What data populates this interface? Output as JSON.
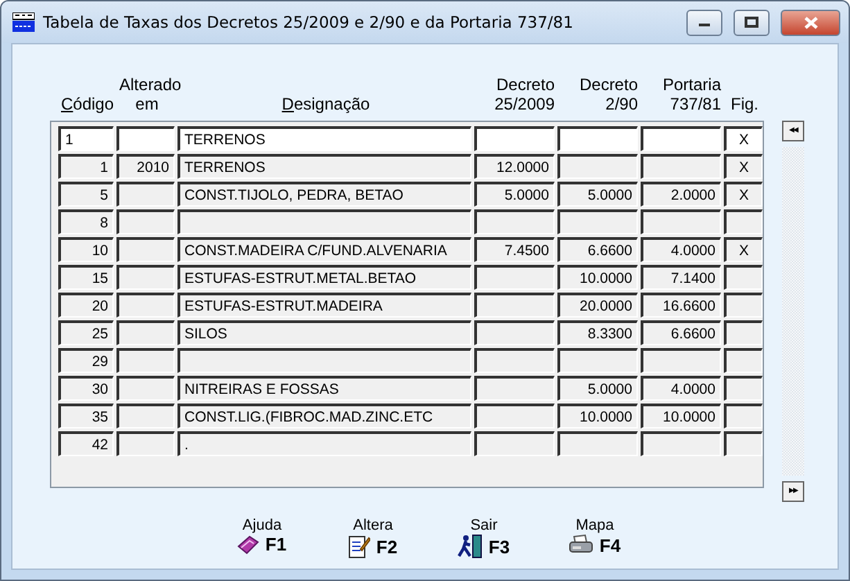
{
  "window": {
    "title": "Tabela de Taxas dos Decretos 25/2009 e 2/90 e da Portaria 737/81"
  },
  "table": {
    "columns": [
      {
        "label": "Código",
        "mnemonic": true
      },
      {
        "label": "Alterado em",
        "mnemonic": false
      },
      {
        "label": "Designação",
        "mnemonic": true
      },
      {
        "label": "Decreto 25/2009",
        "mnemonic": false
      },
      {
        "label": "Decreto 2/90",
        "mnemonic": false
      },
      {
        "label": "Portaria 737/81",
        "mnemonic": false
      },
      {
        "label": "Fig.",
        "mnemonic": false
      }
    ],
    "rows": [
      {
        "kind": "edit",
        "cells": [
          "1",
          "",
          "TERRENOS",
          "",
          "",
          "",
          "X"
        ]
      },
      {
        "kind": "row",
        "cells": [
          "1",
          "2010",
          "TERRENOS",
          "12.0000",
          "",
          "",
          "X"
        ]
      },
      {
        "kind": "row",
        "cells": [
          "5",
          "",
          "CONST.TIJOLO, PEDRA, BETAO",
          "5.0000",
          "5.0000",
          "2.0000",
          "X"
        ]
      },
      {
        "kind": "row",
        "cells": [
          "8",
          "",
          "",
          "",
          "",
          "",
          ""
        ]
      },
      {
        "kind": "row",
        "cells": [
          "10",
          "",
          "CONST.MADEIRA C/FUND.ALVENARIA",
          "7.4500",
          "6.6600",
          "4.0000",
          "X"
        ]
      },
      {
        "kind": "row",
        "cells": [
          "15",
          "",
          "ESTUFAS-ESTRUT.METAL.BETAO",
          "",
          "10.0000",
          "7.1400",
          ""
        ]
      },
      {
        "kind": "row",
        "cells": [
          "20",
          "",
          "ESTUFAS-ESTRUT.MADEIRA",
          "",
          "20.0000",
          "16.6600",
          ""
        ]
      },
      {
        "kind": "row",
        "cells": [
          "25",
          "",
          "SILOS",
          "",
          "8.3300",
          "6.6600",
          ""
        ]
      },
      {
        "kind": "row",
        "cells": [
          "29",
          "",
          "",
          "",
          "",
          "",
          ""
        ]
      },
      {
        "kind": "row",
        "cells": [
          "30",
          "",
          "NITREIRAS E FOSSAS",
          "",
          "5.0000",
          "4.0000",
          ""
        ]
      },
      {
        "kind": "row",
        "cells": [
          "35",
          "",
          "CONST.LIG.(FIBROC.MAD.ZINC.ETC",
          "",
          "10.0000",
          "10.0000",
          ""
        ]
      },
      {
        "kind": "row",
        "cells": [
          "42",
          "",
          ".",
          "",
          "",
          "",
          ""
        ]
      }
    ]
  },
  "scroll": {
    "up": "◀◀",
    "down": "▶▶"
  },
  "actions": [
    {
      "label": "Ajuda",
      "key": "F1"
    },
    {
      "label": "Altera",
      "key": "F2"
    },
    {
      "label": "Sair",
      "key": "F3"
    },
    {
      "label": "Mapa",
      "key": "F4"
    }
  ]
}
